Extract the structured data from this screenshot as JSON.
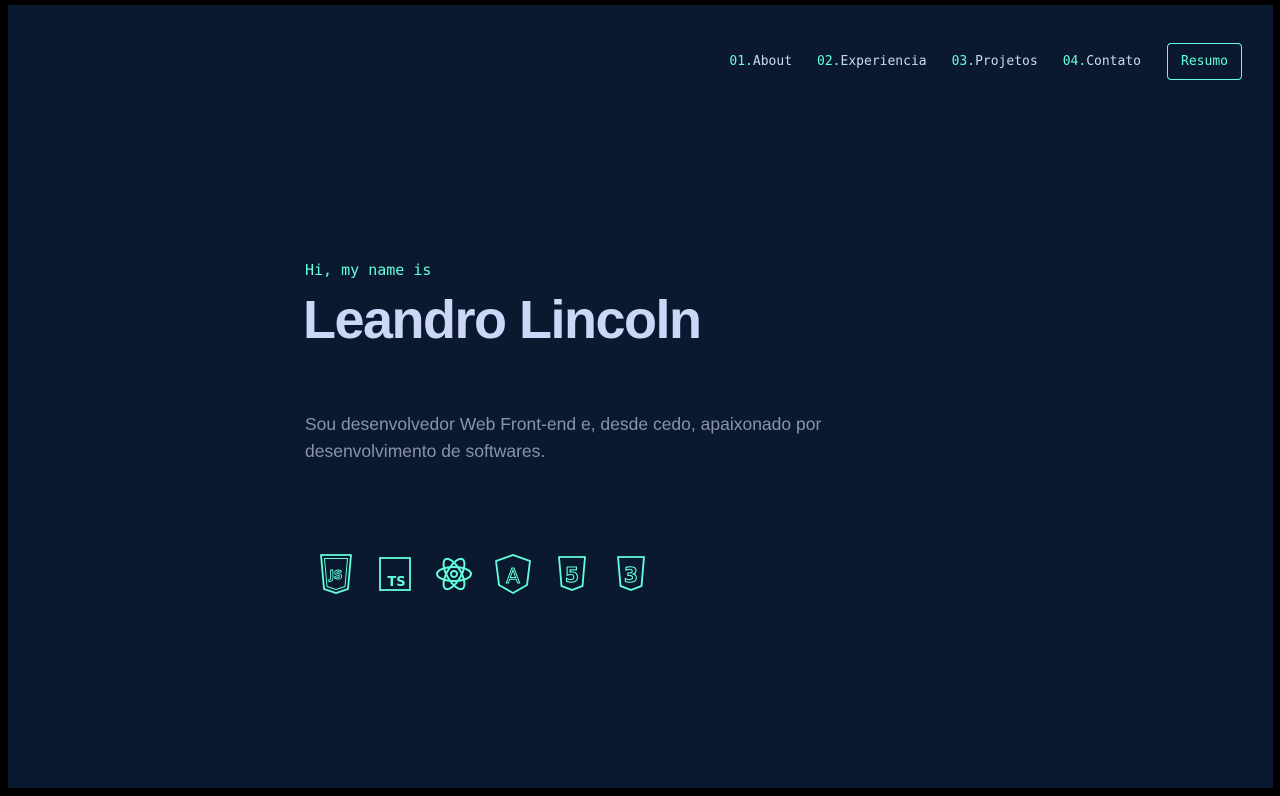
{
  "nav": {
    "items": [
      {
        "num": "01.",
        "label": "About"
      },
      {
        "num": "02.",
        "label": "Experiencia"
      },
      {
        "num": "03.",
        "label": "Projetos"
      },
      {
        "num": "04.",
        "label": "Contato"
      }
    ],
    "resume_label": "Resumo"
  },
  "hero": {
    "greeting": "Hi, my name is",
    "name": "Leandro Lincoln",
    "description": "Sou desenvolvedor Web Front-end e, desde cedo, apaixonado por desenvolvimento de softwares."
  },
  "tech_icons": [
    {
      "name": "javascript-icon",
      "text": "JS"
    },
    {
      "name": "typescript-icon",
      "text": "TS"
    },
    {
      "name": "react-icon"
    },
    {
      "name": "angular-icon",
      "text": "A"
    },
    {
      "name": "html5-icon",
      "text": "5"
    },
    {
      "name": "css3-icon",
      "text": "3"
    }
  ],
  "colors": {
    "background": "#0a192f",
    "accent": "#64ffda",
    "heading": "#ccd6f6",
    "body_text": "#8892b0"
  }
}
